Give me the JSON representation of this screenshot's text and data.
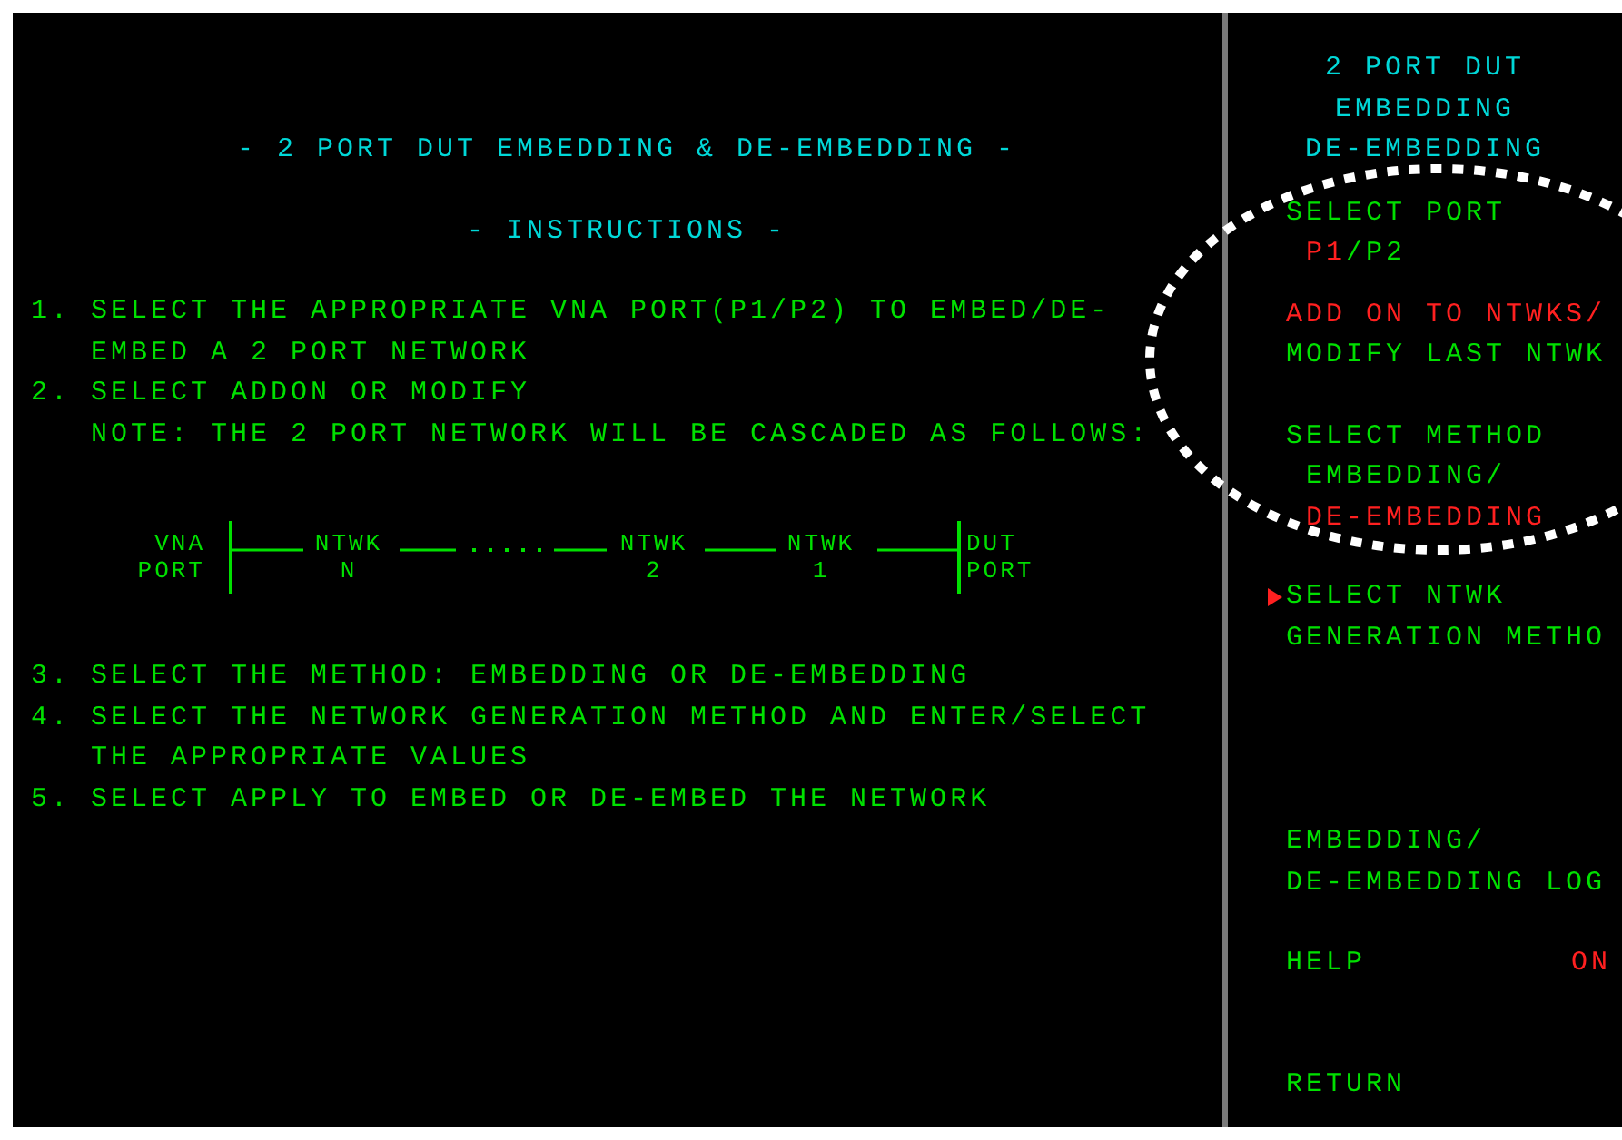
{
  "main": {
    "title": "- 2 PORT DUT EMBEDDING & DE-EMBEDDING -",
    "subtitle": "- INSTRUCTIONS -",
    "instructions_before": [
      {
        "number": "1.",
        "lines": [
          "SELECT THE APPROPRIATE VNA PORT(P1/P2) TO EMBED/DE-",
          "EMBED A 2 PORT NETWORK"
        ]
      },
      {
        "number": "2.",
        "lines": [
          "SELECT ADDON OR MODIFY",
          "NOTE: THE 2 PORT NETWORK WILL BE CASCADED AS FOLLOWS:"
        ]
      }
    ],
    "diagram": {
      "left_label": [
        "VNA",
        "PORT"
      ],
      "networks": [
        {
          "name": "NTWK",
          "index": "N"
        },
        {
          "name": "NTWK",
          "index": "2"
        },
        {
          "name": "NTWK",
          "index": "1"
        }
      ],
      "right_label": [
        "DUT",
        "PORT"
      ]
    },
    "instructions_after": [
      {
        "number": "3.",
        "lines": [
          "SELECT THE METHOD: EMBEDDING OR DE-EMBEDDING"
        ]
      },
      {
        "number": "4.",
        "lines": [
          "SELECT THE NETWORK GENERATION METHOD AND ENTER/SELECT",
          "THE APPROPRIATE VALUES"
        ]
      },
      {
        "number": "5.",
        "lines": [
          "SELECT APPLY TO EMBED OR DE-EMBED THE NETWORK"
        ]
      }
    ]
  },
  "softkey_menu": {
    "title": [
      "2 PORT DUT",
      "EMBEDDING",
      "DE-EMBEDDING"
    ],
    "items": [
      {
        "kind": "text",
        "current": false,
        "lines": [
          {
            "indented": false,
            "segments": [
              {
                "text": "SELECT PORT",
                "highlighted": false
              }
            ]
          },
          {
            "indented": true,
            "segments": [
              {
                "text": "P1",
                "highlighted": true
              },
              {
                "text": "/P2",
                "highlighted": false
              }
            ]
          }
        ]
      },
      {
        "kind": "text",
        "current": false,
        "lines": [
          {
            "indented": false,
            "segments": [
              {
                "text": "ADD ON TO NTWKS/",
                "highlighted": true
              }
            ]
          },
          {
            "indented": false,
            "segments": [
              {
                "text": "MODIFY LAST NTWK",
                "highlighted": false
              }
            ]
          }
        ]
      },
      {
        "kind": "text",
        "current": false,
        "lines": [
          {
            "indented": false,
            "segments": [
              {
                "text": "SELECT METHOD",
                "highlighted": false
              }
            ]
          },
          {
            "indented": true,
            "segments": [
              {
                "text": "EMBEDDING/",
                "highlighted": false
              }
            ]
          },
          {
            "indented": true,
            "segments": [
              {
                "text": "DE-EMBEDDING",
                "highlighted": true
              }
            ]
          }
        ]
      },
      {
        "kind": "text",
        "current": true,
        "lines": [
          {
            "indented": false,
            "segments": [
              {
                "text": "SELECT NTWK",
                "highlighted": false
              }
            ]
          },
          {
            "indented": false,
            "segments": [
              {
                "text": "GENERATION METHO",
                "highlighted": false
              }
            ]
          }
        ]
      },
      {
        "kind": "text",
        "current": false,
        "lines": [
          {
            "indented": false,
            "segments": [
              {
                "text": "EMBEDDING/",
                "highlighted": false
              }
            ]
          },
          {
            "indented": false,
            "segments": [
              {
                "text": "DE-EMBEDDING LOG",
                "highlighted": false
              }
            ]
          }
        ]
      },
      {
        "kind": "toggle",
        "current": false,
        "label": "HELP",
        "value": "ON"
      },
      {
        "kind": "text",
        "current": false,
        "lines": [
          {
            "indented": false,
            "segments": [
              {
                "text": "RETURN",
                "highlighted": false
              }
            ]
          }
        ]
      }
    ]
  }
}
